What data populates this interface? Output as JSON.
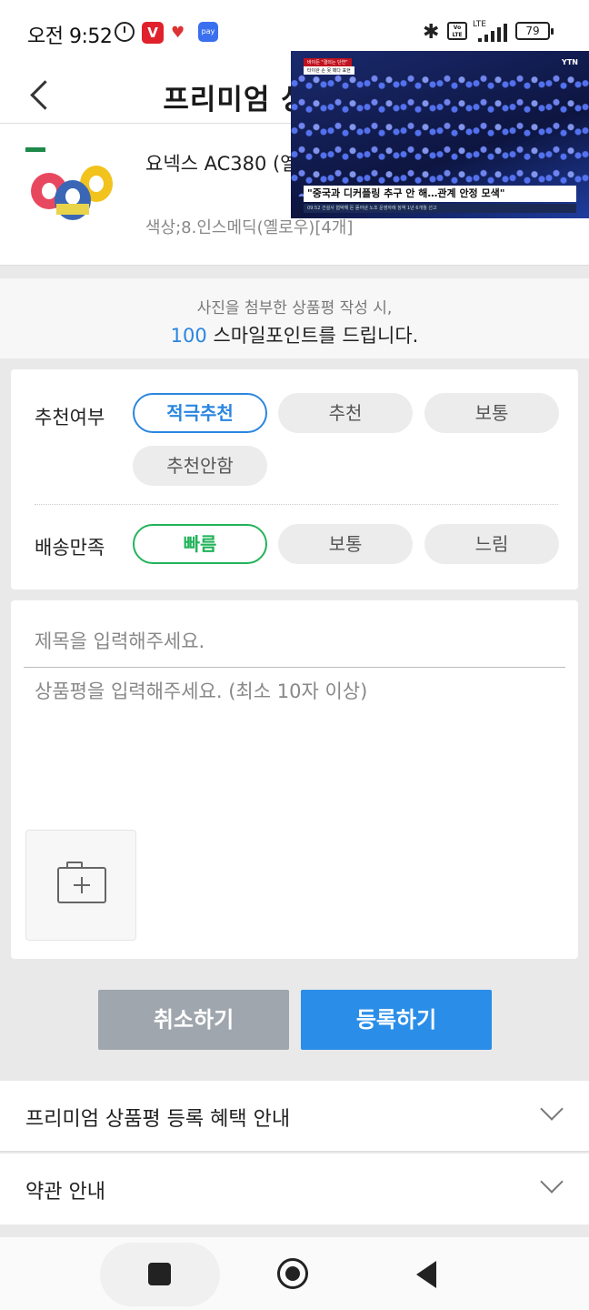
{
  "status_bar": {
    "time": "오전 9:52",
    "battery": "79",
    "network": "LTE",
    "app_red_letter": "V",
    "pay_label": "pay",
    "volte_label": "Vo LTE"
  },
  "header": {
    "title": "프리미엄 상품평 작성"
  },
  "product": {
    "name": "요넥스 AC380 (옐로우) 언더랩 배드민턴그립",
    "option": "색상;8.인스메딕(옐로우)[4개]"
  },
  "video_overlay": {
    "caption": "\"중국과 디커플링 추구 안 해…관계 안정 모색\"",
    "logo": "YTN",
    "chip_top": "바이든 \"결의는 단연\"",
    "chip_sub": "타이완 손 못 떼다 표현",
    "ticker": "09:52 건설사 협박해 돈 뜯어낸 노조 운영자에 징역 1년 6개월 선고"
  },
  "notice": {
    "line1": "사진을 첨부한 상품평 작성 시,",
    "points": "100",
    "line2_rest": " 스마일포인트를 드립니다."
  },
  "recommend": {
    "label": "추천여부",
    "options": [
      "적극추천",
      "추천",
      "보통",
      "추천안함"
    ],
    "selected": "적극추천"
  },
  "delivery": {
    "label": "배송만족",
    "options": [
      "빠름",
      "보통",
      "느림"
    ],
    "selected": "빠름"
  },
  "review": {
    "title_placeholder": "제목을 입력해주세요.",
    "body_placeholder": "상품평을 입력해주세요. (최소 10자 이상)"
  },
  "actions": {
    "cancel_label": "취소하기",
    "submit_label": "등록하기"
  },
  "accordions": {
    "benefit_label": "프리미엄 상품평 등록 혜택 안내",
    "terms_label": "약관 안내"
  },
  "colors": {
    "accent_blue": "#2a86e0",
    "accent_green": "#22b35a",
    "cancel_gray": "#9fa6ad",
    "submit_blue": "#2a8ee8"
  }
}
